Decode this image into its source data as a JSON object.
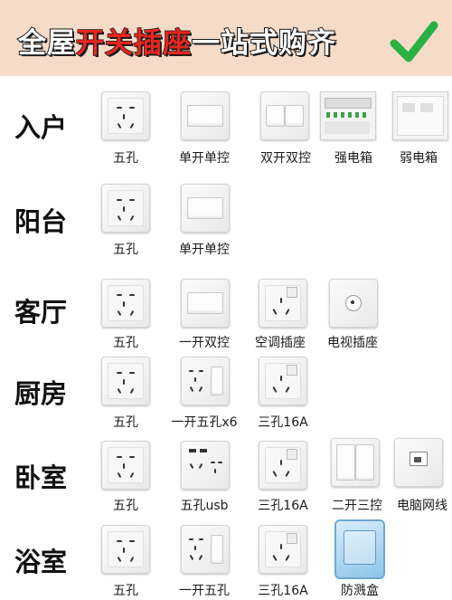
{
  "header": {
    "title_part1": "全屋",
    "title_part2": "开关插座",
    "title_part3": "一站式购齐",
    "check_icon": "green-check-icon",
    "accent_color": "#e8251f",
    "banner_color": "#f6dcc8",
    "check_color": "#2ab045"
  },
  "rooms": [
    {
      "label": "入户",
      "items": [
        "五孔",
        "单开单控",
        "双开双控",
        "强电箱",
        "弱电箱"
      ]
    },
    {
      "label": "阳台",
      "items": [
        "五孔",
        "单开单控"
      ]
    },
    {
      "label": "客厅",
      "items": [
        "五孔",
        "一开双控",
        "空调插座",
        "电视插座"
      ]
    },
    {
      "label": "厨房",
      "items": [
        "五孔",
        "一开五孔x6",
        "三孔16A"
      ]
    },
    {
      "label": "卧室",
      "items": [
        "五孔",
        "五孔usb",
        "三孔16A",
        "二开三控",
        "电脑网线"
      ]
    },
    {
      "label": "浴室",
      "items": [
        "五孔",
        "一开五孔",
        "三孔16A",
        "防溅盒"
      ]
    }
  ]
}
